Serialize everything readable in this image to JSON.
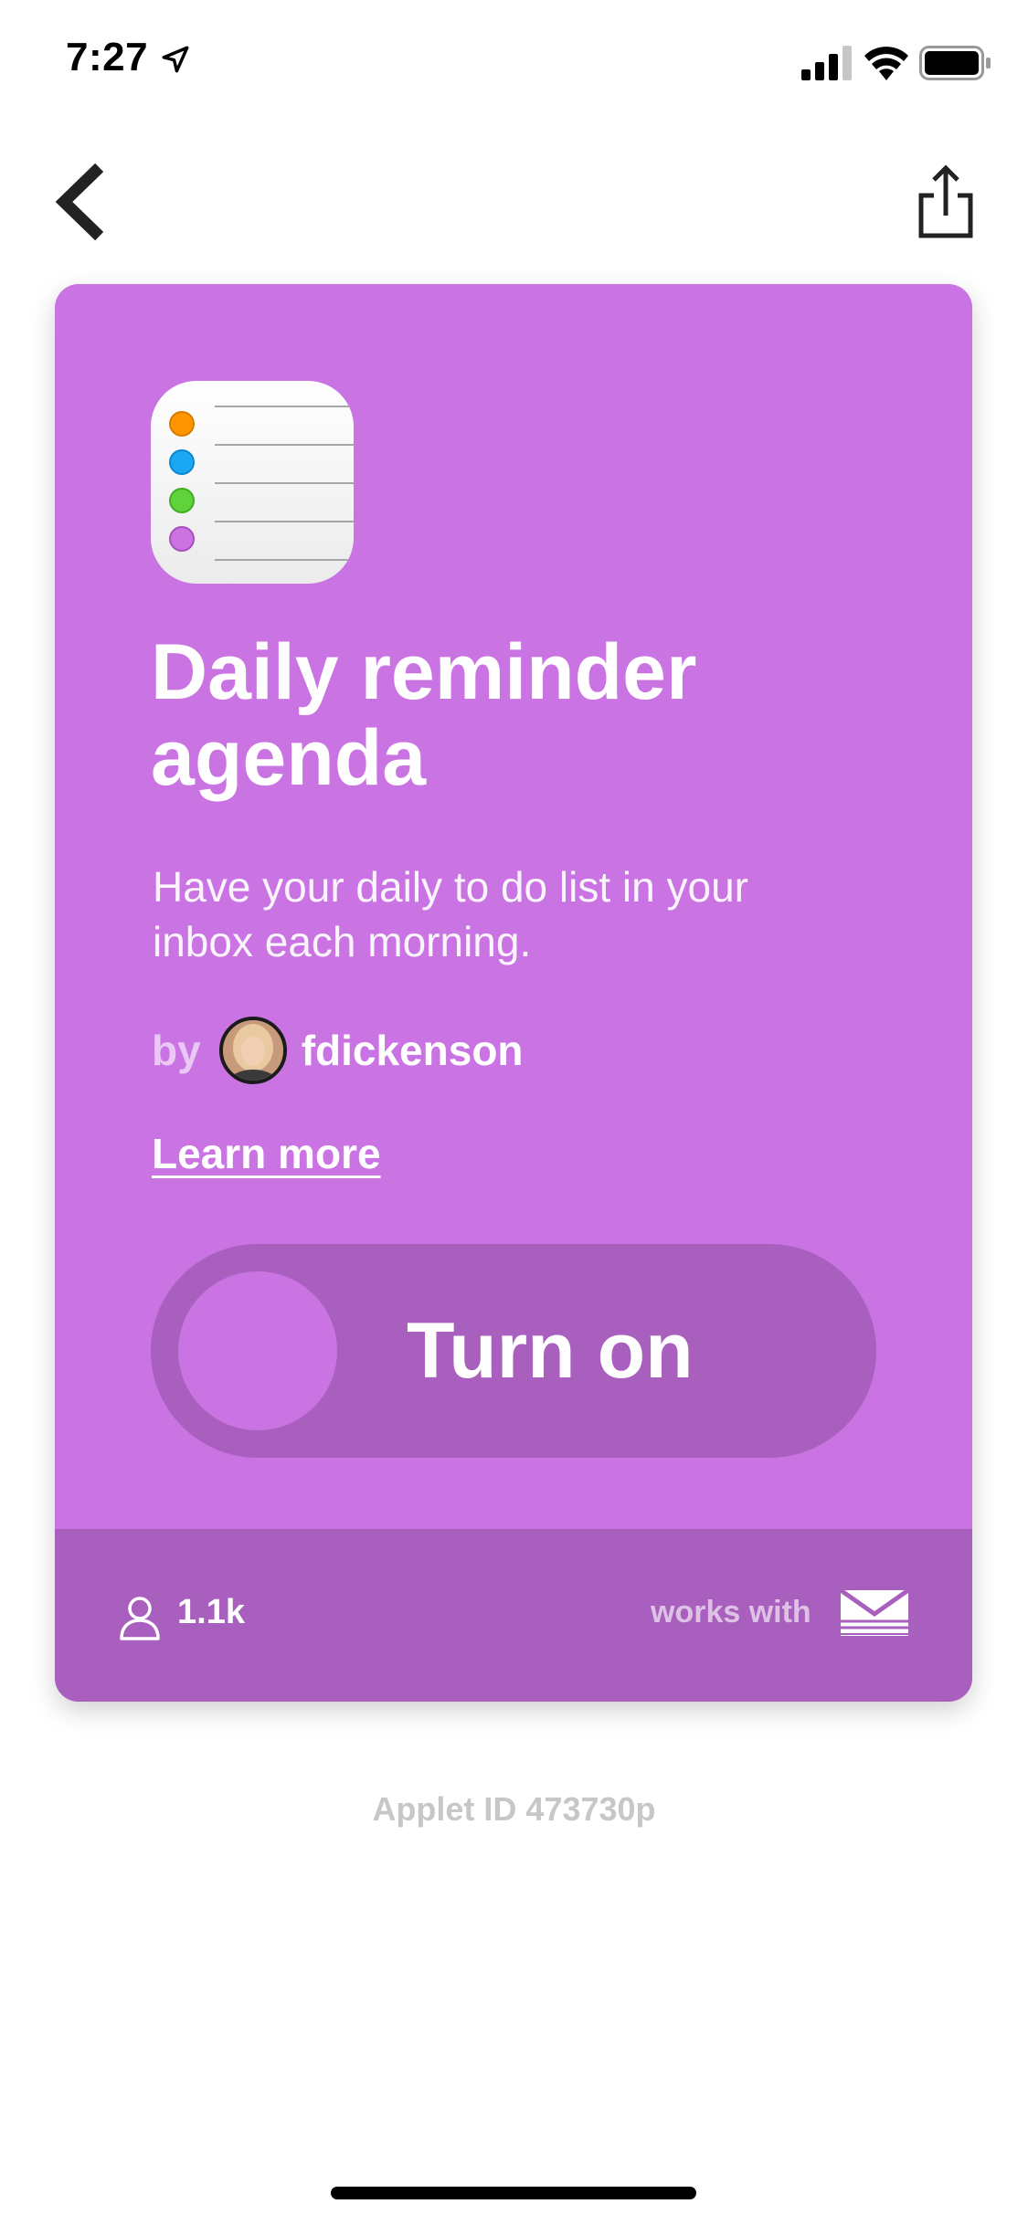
{
  "status_bar": {
    "time": "7:27",
    "icons": [
      "location-arrow-icon",
      "cellular-signal-icon",
      "wifi-icon",
      "battery-icon"
    ]
  },
  "nav": {
    "back_icon": "chevron-left-icon",
    "share_icon": "share-icon"
  },
  "card": {
    "background_color": "#ca74e3",
    "accent_dark_color": "#a95fbd",
    "app_icon": "reminders-app-icon",
    "title": "Daily reminder agenda",
    "description": "Have your daily to do list in your inbox each morning.",
    "by_label": "by",
    "author": "fdickenson",
    "learn_more": "Learn more",
    "toggle": {
      "label": "Turn on",
      "state": "off"
    },
    "footer": {
      "user_count": "1.1k",
      "works_with_label": "works with",
      "service_icon": "email-icon"
    }
  },
  "applet_id": "Applet ID 473730p"
}
